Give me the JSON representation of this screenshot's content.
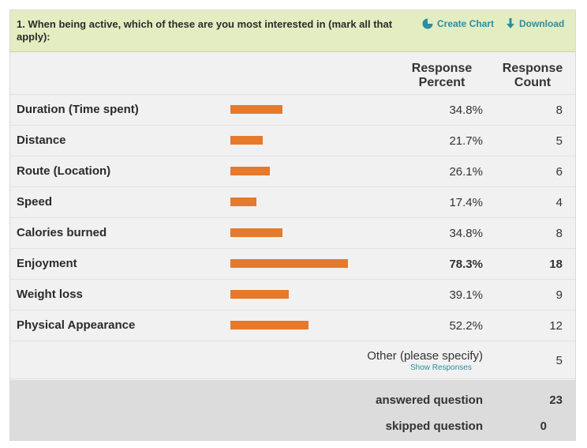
{
  "question": {
    "text": "1. When being active, which of these are you most interested in (mark all that apply):",
    "create_chart_label": "Create Chart",
    "download_label": "Download",
    "create_chart_icon": "pie-chart-icon",
    "download_icon": "download-arrow-icon",
    "accent_color": "#2a8ea0",
    "header_bg": "#e3edc1"
  },
  "columns": {
    "percent": "Response Percent",
    "count": "Response Count"
  },
  "chart_data": {
    "type": "bar",
    "categories": [
      "Duration (Time spent)",
      "Distance",
      "Route (Location)",
      "Speed",
      "Calories burned",
      "Enjoyment",
      "Weight loss",
      "Physical Appearance"
    ],
    "values": [
      34.8,
      21.7,
      26.1,
      17.4,
      34.8,
      78.3,
      39.1,
      52.2
    ],
    "bar_color": "#e5792c"
  },
  "rows": [
    {
      "label": "Duration (Time spent)",
      "percent": "34.8%",
      "count": "8"
    },
    {
      "label": "Distance",
      "percent": "21.7%",
      "count": "5"
    },
    {
      "label": "Route (Location)",
      "percent": "26.1%",
      "count": "6"
    },
    {
      "label": "Speed",
      "percent": "17.4%",
      "count": "4"
    },
    {
      "label": "Calories burned",
      "percent": "34.8%",
      "count": "8"
    },
    {
      "label": "Enjoyment",
      "percent": "78.3%",
      "count": "18"
    },
    {
      "label": "Weight loss",
      "percent": "39.1%",
      "count": "9"
    },
    {
      "label": "Physical Appearance",
      "percent": "52.2%",
      "count": "12"
    }
  ],
  "other": {
    "label": "Other (please specify)",
    "show_responses": "Show Responses",
    "count": "5"
  },
  "summary": {
    "answered_label": "answered question",
    "answered_value": "23",
    "skipped_label": "skipped question",
    "skipped_value": "0"
  }
}
